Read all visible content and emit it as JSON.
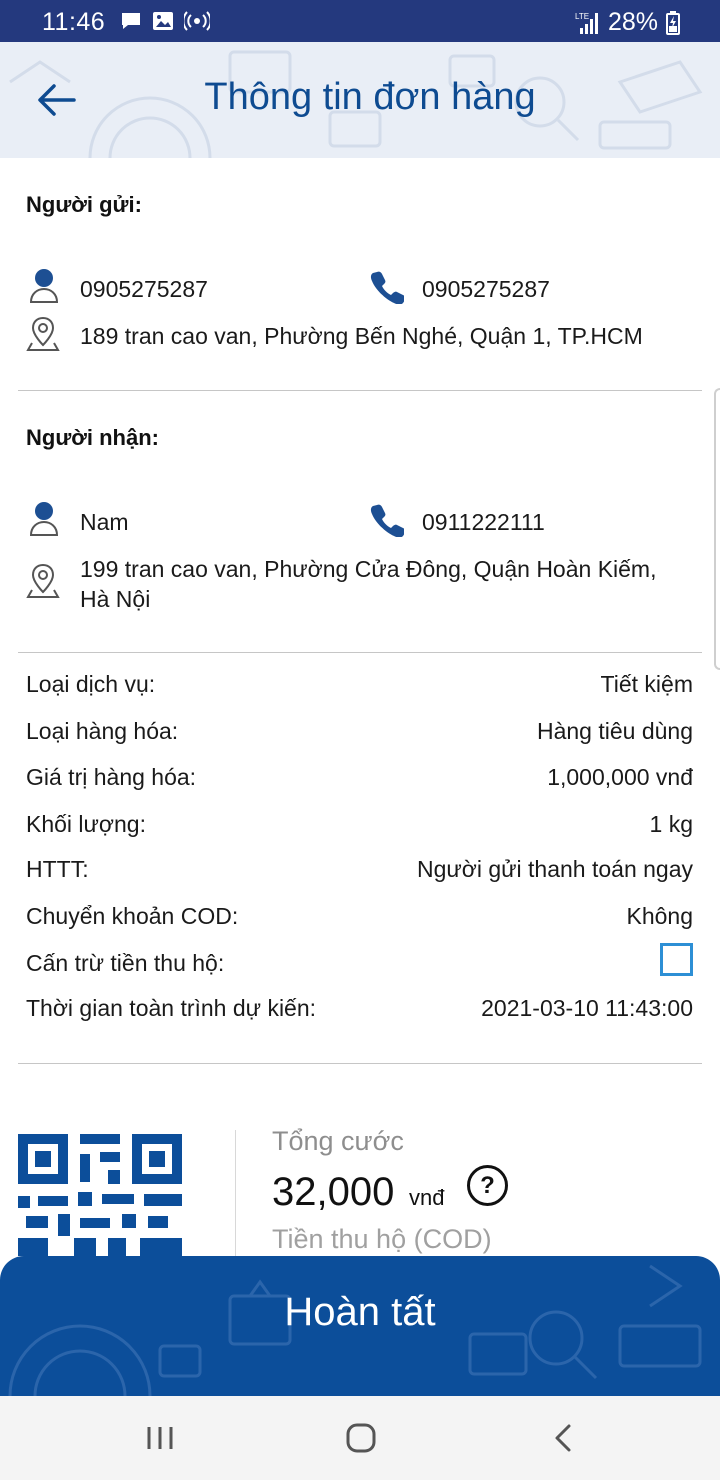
{
  "status_bar": {
    "time": "11:46",
    "battery": "28%",
    "network": "LTE"
  },
  "header": {
    "title": "Thông tin đơn hàng"
  },
  "sender": {
    "section_label": "Người gửi:",
    "name": "0905275287",
    "phone": "0905275287",
    "address": "189 tran cao van, Phường Bến Nghé, Quận 1, TP.HCM"
  },
  "receiver": {
    "section_label": "Người nhận:",
    "name": "Nam",
    "phone": "0911222111",
    "address_line1": "199 tran cao van, Phường Cửa Đông, Quận Hoàn Kiếm,",
    "address_line2": "Hà Nội"
  },
  "details": [
    {
      "label": "Loại dịch vụ:",
      "value": "Tiết kiệm"
    },
    {
      "label": "Loại hàng hóa:",
      "value": "Hàng tiêu dùng"
    },
    {
      "label": "Giá trị hàng hóa:",
      "value": "1,000,000 vnđ"
    },
    {
      "label": "Khối lượng:",
      "value": "1 kg"
    },
    {
      "label": "HTTT:",
      "value": "Người gửi thanh toán ngay"
    },
    {
      "label": "Chuyển khoản COD:",
      "value": "Không"
    },
    {
      "label": "Cấn trừ tiền thu hộ:",
      "checked": false
    },
    {
      "label": "Thời gian toàn trình dự kiến:",
      "value": "2021-03-10 11:43:00"
    }
  ],
  "summary": {
    "total_label": "Tổng cước",
    "total_amount": "32,000",
    "total_unit": "vnđ",
    "help_icon_text": "?",
    "cod_label": "Tiền thu hộ (COD)"
  },
  "actions": {
    "finish_label": "Hoàn tất"
  },
  "colors": {
    "status_bar": "#24397e",
    "title": "#0e4b91",
    "icon_blue": "#1d4f93",
    "primary_button": "#0c4e9a",
    "checkbox_border": "#2d8fd5"
  }
}
